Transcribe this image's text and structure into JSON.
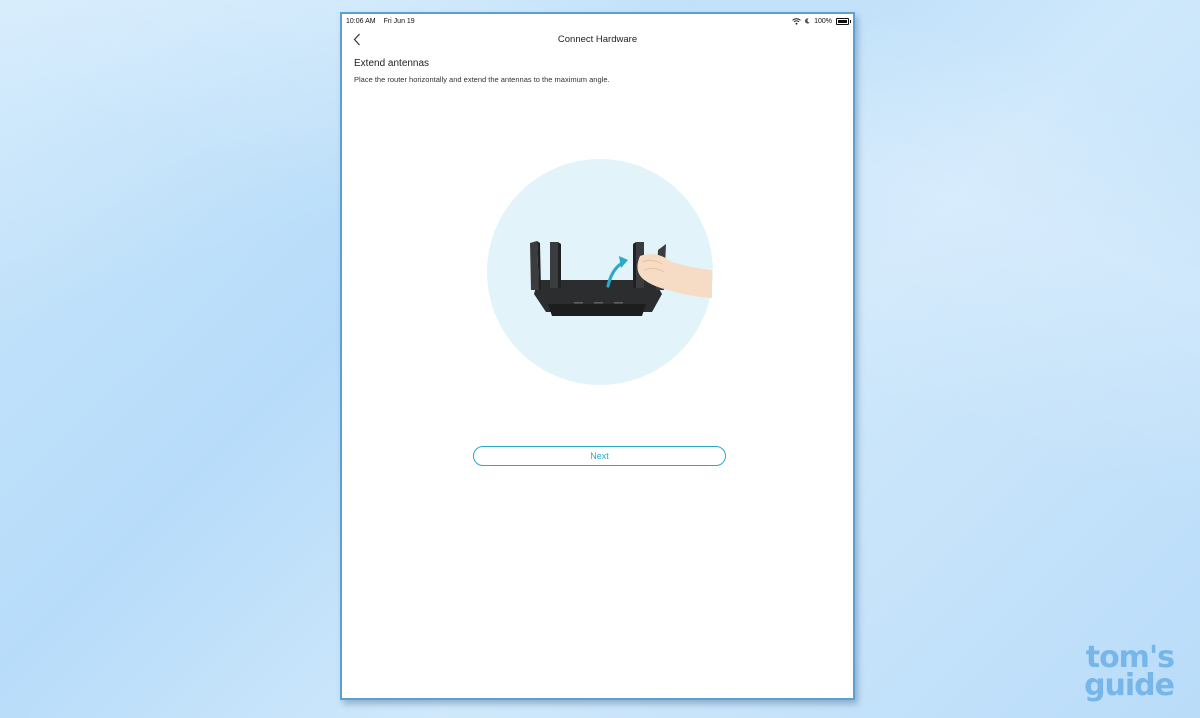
{
  "status_bar": {
    "time": "10:06 AM",
    "date": "Fri Jun 19",
    "battery": "100%"
  },
  "nav": {
    "title": "Connect Hardware"
  },
  "content": {
    "heading": "Extend antennas",
    "description": "Place the router horizontally and extend the antennas to the maximum angle."
  },
  "actions": {
    "next_label": "Next"
  },
  "watermark": {
    "line1": "tom's",
    "line2": "guide"
  },
  "colors": {
    "accent": "#2aa9c8",
    "illustration_bg": "#e2f4fa",
    "router": "#2b2d2f"
  },
  "icons": {
    "back": "chevron-left-icon",
    "wifi": "wifi-icon",
    "moon": "moon-icon",
    "battery": "battery-icon"
  }
}
